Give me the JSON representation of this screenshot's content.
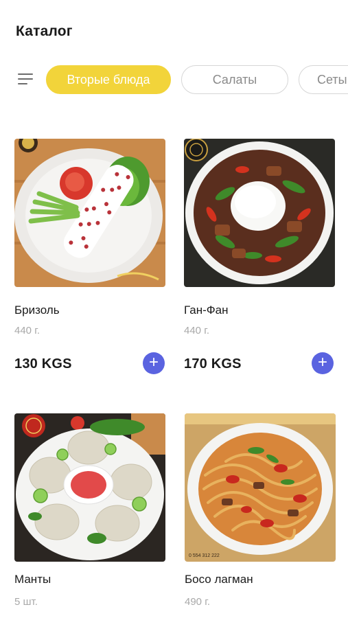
{
  "header": {
    "title": "Каталог"
  },
  "filters": {
    "menu_icon": "filter-lines-icon",
    "chips": [
      {
        "label": "Вторые блюда",
        "active": true
      },
      {
        "label": "Салаты",
        "active": false
      },
      {
        "label": "Сеты",
        "active": false
      }
    ]
  },
  "products": [
    {
      "name": "Бризоль",
      "weight": "440 г.",
      "price": "130 KGS",
      "add_icon": "plus-icon"
    },
    {
      "name": "Ган-Фан",
      "weight": "440 г.",
      "price": "170 KGS",
      "add_icon": "plus-icon"
    },
    {
      "name": "Манты",
      "weight": "5 шт.",
      "price": "",
      "add_icon": "plus-icon"
    },
    {
      "name": "Босо лагман",
      "weight": "490 г.",
      "price": "",
      "add_icon": "plus-icon"
    }
  ],
  "image_texts": {
    "phone": "0 554 312 222"
  },
  "colors": {
    "accent_chip": "#f2d43a",
    "add_button": "#5a63e0"
  }
}
